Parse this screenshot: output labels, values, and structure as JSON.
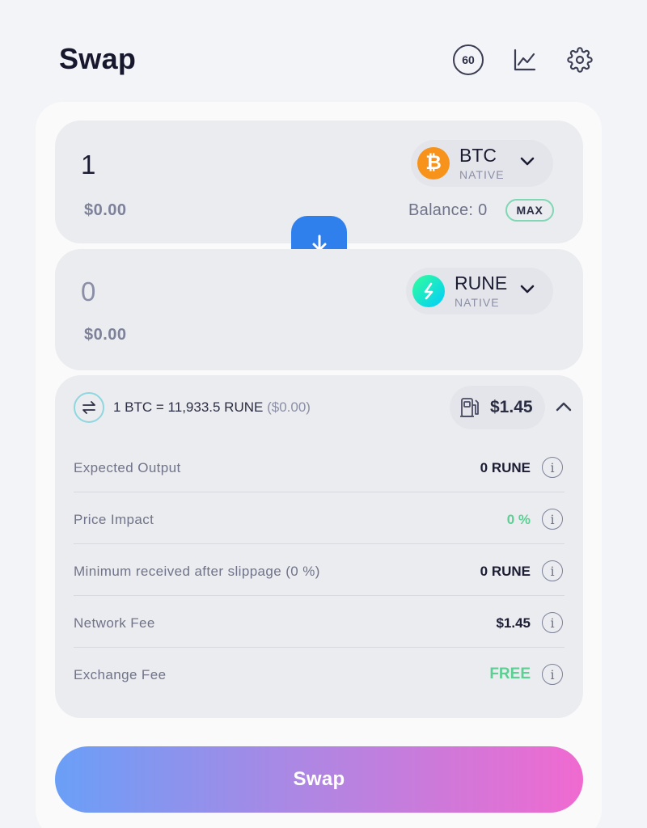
{
  "header": {
    "title": "Swap",
    "timer_value": "60",
    "icons": [
      "timer-icon",
      "chart-icon",
      "gear-icon"
    ]
  },
  "from": {
    "amount": "1",
    "usd_value": "$0.00",
    "asset_symbol": "BTC",
    "asset_network": "NATIVE",
    "balance_label": "Balance: 0",
    "max_label": "MAX"
  },
  "to": {
    "amount": "0",
    "usd_value": "$0.00",
    "asset_symbol": "RUNE",
    "asset_network": "NATIVE"
  },
  "details": {
    "rate": "1 BTC = 11,933.5 RUNE",
    "rate_usd": "($0.00)",
    "total_fee": "$1.45",
    "rows": [
      {
        "label": "Expected Output",
        "value": "0 RUNE"
      },
      {
        "label": "Price Impact",
        "value": "0 %"
      },
      {
        "label": "Minimum received after slippage (0 %)",
        "value": "0 RUNE"
      },
      {
        "label": "Network Fee",
        "value": "$1.45"
      },
      {
        "label": "Exchange Fee",
        "value": "FREE"
      }
    ]
  },
  "swap_button_label": "Swap",
  "colors": {
    "accent_blue": "#2f80ed",
    "positive_green": "#5ccf93",
    "btc_orange": "#f7931a",
    "button_gradient_start": "#6a9ff7",
    "button_gradient_end": "#f06ad0"
  }
}
